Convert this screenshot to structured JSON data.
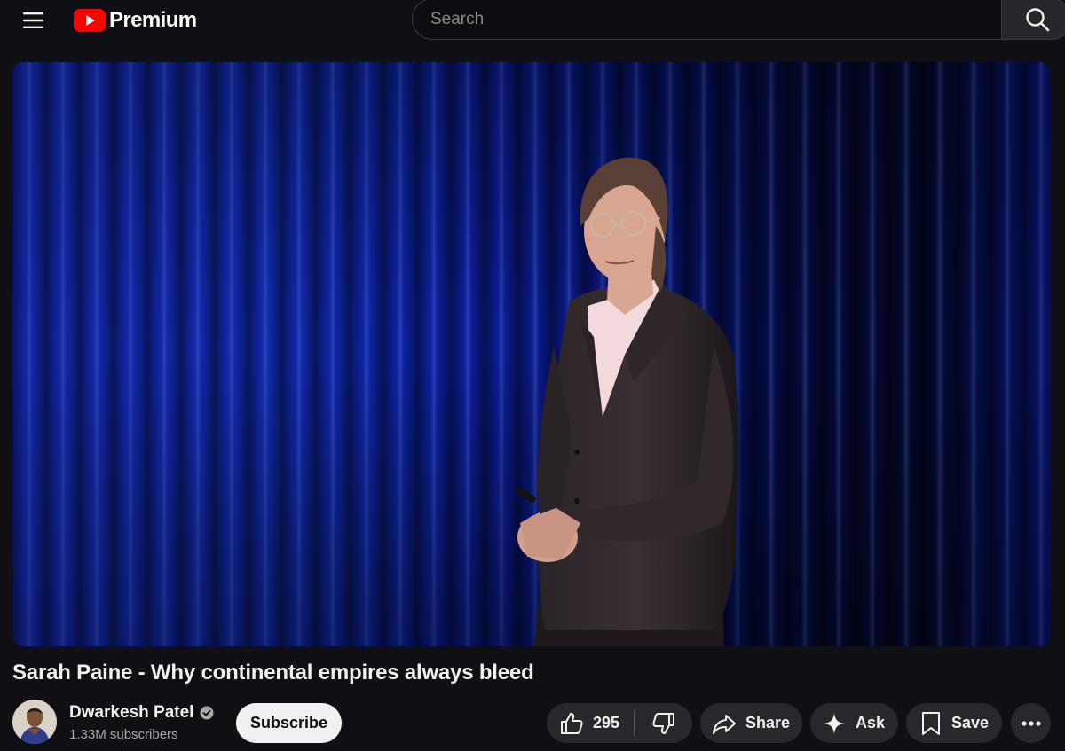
{
  "header": {
    "logo_text": "Premium",
    "search_placeholder": "Search",
    "icons": [
      "hamburger-menu-icon",
      "youtube-play-icon",
      "search-icon"
    ]
  },
  "video": {
    "title": "Sarah Paine - Why continental empires always bleed"
  },
  "channel": {
    "name": "Dwarkesh Patel",
    "verified": true,
    "subscribers": "1.33M subscribers",
    "subscribe_label": "Subscribe"
  },
  "actions": {
    "like_count": "295",
    "share_label": "Share",
    "ask_label": "Ask",
    "save_label": "Save"
  },
  "colors": {
    "background": "#0f0f14",
    "brand_red": "#ff0000",
    "pill_bg": "#27272c",
    "subscribe_bg": "#f1f1f1",
    "curtain_blue": "#1a3cff"
  }
}
